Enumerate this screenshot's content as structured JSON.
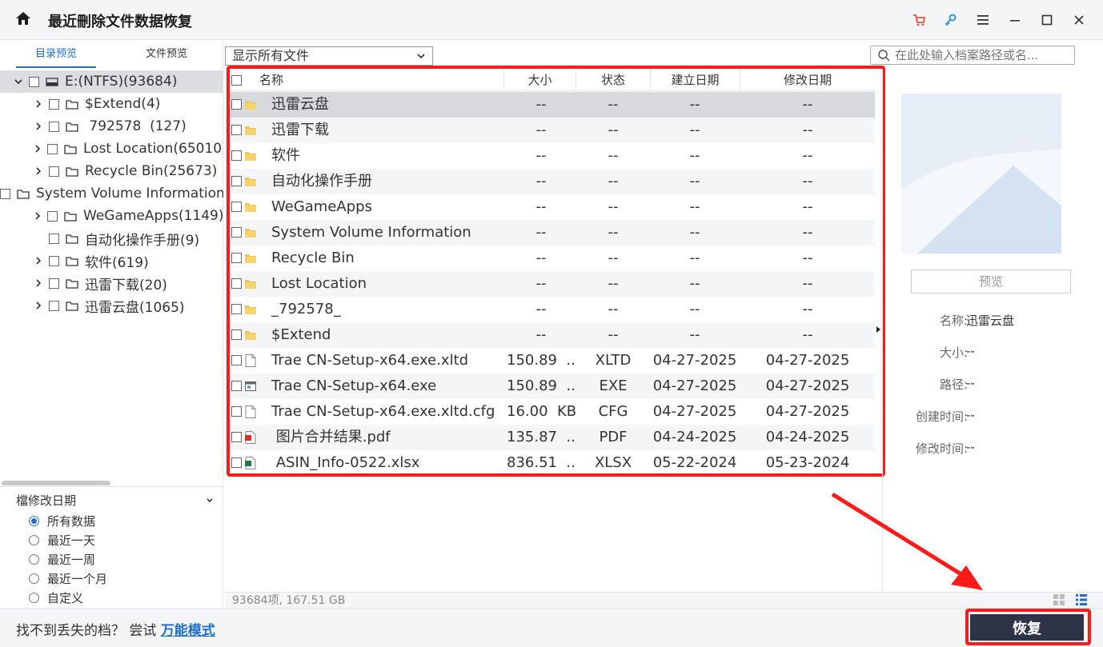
{
  "app": {
    "title": "最近刪除文件数据恢复"
  },
  "icons": {
    "home": "home-icon",
    "cart": "cart-icon",
    "key": "key-icon",
    "menu": "menu-icon",
    "minimize": "minimize-icon",
    "maximize": "maximize-icon",
    "close": "close-icon"
  },
  "colors": {
    "accent": "#1f6fd0",
    "highlight": "#ff1a1a",
    "recover_btn": "#2d3448",
    "cart": "#e8553c"
  },
  "left": {
    "tabs": [
      {
        "label": "目录预览",
        "active": true
      },
      {
        "label": "文件预览",
        "active": false
      }
    ],
    "tree": [
      {
        "label": "E:(NTFS)(93684)",
        "level": 0,
        "expandable": true,
        "expanded": true,
        "icon": "drive-icon",
        "selected": true
      },
      {
        "label": "$Extend(4)",
        "level": 1,
        "expandable": true
      },
      {
        "label": " 792578  (127)",
        "level": 1,
        "expandable": true
      },
      {
        "label": "Lost Location(65010)",
        "level": 1,
        "expandable": true
      },
      {
        "label": "Recycle Bin(25673)",
        "level": 1,
        "expandable": true
      },
      {
        "label": "System Volume Information",
        "level": 1,
        "expandable": false
      },
      {
        "label": "WeGameApps(1149)",
        "level": 1,
        "expandable": true
      },
      {
        "label": "自动化操作手册(9)",
        "level": 1,
        "expandable": false
      },
      {
        "label": "软件(619)",
        "level": 1,
        "expandable": true
      },
      {
        "label": "迅雷下载(20)",
        "level": 1,
        "expandable": true
      },
      {
        "label": "迅雷云盘(1065)",
        "level": 1,
        "expandable": true
      }
    ],
    "filter": {
      "title": "檔修改日期",
      "options": [
        {
          "label": "所有数据",
          "checked": true
        },
        {
          "label": "最近一天",
          "checked": false
        },
        {
          "label": "最近一周",
          "checked": false
        },
        {
          "label": "最近一个月",
          "checked": false
        },
        {
          "label": "自定义",
          "checked": false
        }
      ]
    }
  },
  "toolbar": {
    "filter_select": "显示所有文件",
    "search_placeholder": "在此处输入档案路径或名..."
  },
  "table": {
    "columns": [
      "名称",
      "大小",
      "状态",
      "建立日期",
      "修改日期"
    ],
    "rows": [
      {
        "name": "迅雷云盘",
        "size": "--",
        "status": "--",
        "created": "--",
        "modified": "--",
        "icon": "folder-icon",
        "selected": true
      },
      {
        "name": "迅雷下载",
        "size": "--",
        "status": "--",
        "created": "--",
        "modified": "--",
        "icon": "folder-icon"
      },
      {
        "name": "软件",
        "size": "--",
        "status": "--",
        "created": "--",
        "modified": "--",
        "icon": "folder-icon"
      },
      {
        "name": "自动化操作手册",
        "size": "--",
        "status": "--",
        "created": "--",
        "modified": "--",
        "icon": "folder-icon"
      },
      {
        "name": "WeGameApps",
        "size": "--",
        "status": "--",
        "created": "--",
        "modified": "--",
        "icon": "folder-icon"
      },
      {
        "name": "System Volume Information",
        "size": "--",
        "status": "--",
        "created": "--",
        "modified": "--",
        "icon": "folder-icon"
      },
      {
        "name": "Recycle Bin",
        "size": "--",
        "status": "--",
        "created": "--",
        "modified": "--",
        "icon": "folder-icon"
      },
      {
        "name": "Lost Location",
        "size": "--",
        "status": "--",
        "created": "--",
        "modified": "--",
        "icon": "folder-icon"
      },
      {
        "name": "_792578_",
        "size": "--",
        "status": "--",
        "created": "--",
        "modified": "--",
        "icon": "folder-icon"
      },
      {
        "name": "$Extend",
        "size": "--",
        "status": "--",
        "created": "--",
        "modified": "--",
        "icon": "folder-icon"
      },
      {
        "name": "Trae CN-Setup-x64.exe.xltd",
        "size": "150.89  ...",
        "status": "XLTD",
        "created": "04-27-2025",
        "modified": "04-27-2025",
        "icon": "file-icon"
      },
      {
        "name": "Trae CN-Setup-x64.exe",
        "size": "150.89  ...",
        "status": "EXE",
        "created": "04-27-2025",
        "modified": "04-27-2025",
        "icon": "exe-icon"
      },
      {
        "name": "Trae CN-Setup-x64.exe.xltd.cfg",
        "size": "16.00  KB",
        "status": "CFG",
        "created": "04-27-2025",
        "modified": "04-27-2025",
        "icon": "file-icon"
      },
      {
        "name": " 图片合并结果.pdf",
        "size": "135.87  ...",
        "status": "PDF",
        "created": "04-24-2025",
        "modified": "04-24-2025",
        "icon": "pdf-icon"
      },
      {
        "name": " ASIN_Info-0522.xlsx",
        "size": "836.51  ...",
        "status": "XLSX",
        "created": "05-22-2024",
        "modified": "05-23-2024",
        "icon": "xlsx-icon"
      }
    ]
  },
  "status_bar": {
    "summary": "93684项, 167.51  GB"
  },
  "preview": {
    "button": "预览",
    "info": [
      {
        "label": "名称:",
        "value": "迅雷云盘"
      },
      {
        "label": "大小:",
        "value": "--"
      },
      {
        "label": "路径:",
        "value": "--"
      },
      {
        "label": "创建时间:",
        "value": "--"
      },
      {
        "label": "修改时间:",
        "value": "--"
      }
    ]
  },
  "bottom": {
    "hint": "找不到丢失的档？ 尝试 ",
    "link": "万能模式",
    "recover": "恢复"
  }
}
